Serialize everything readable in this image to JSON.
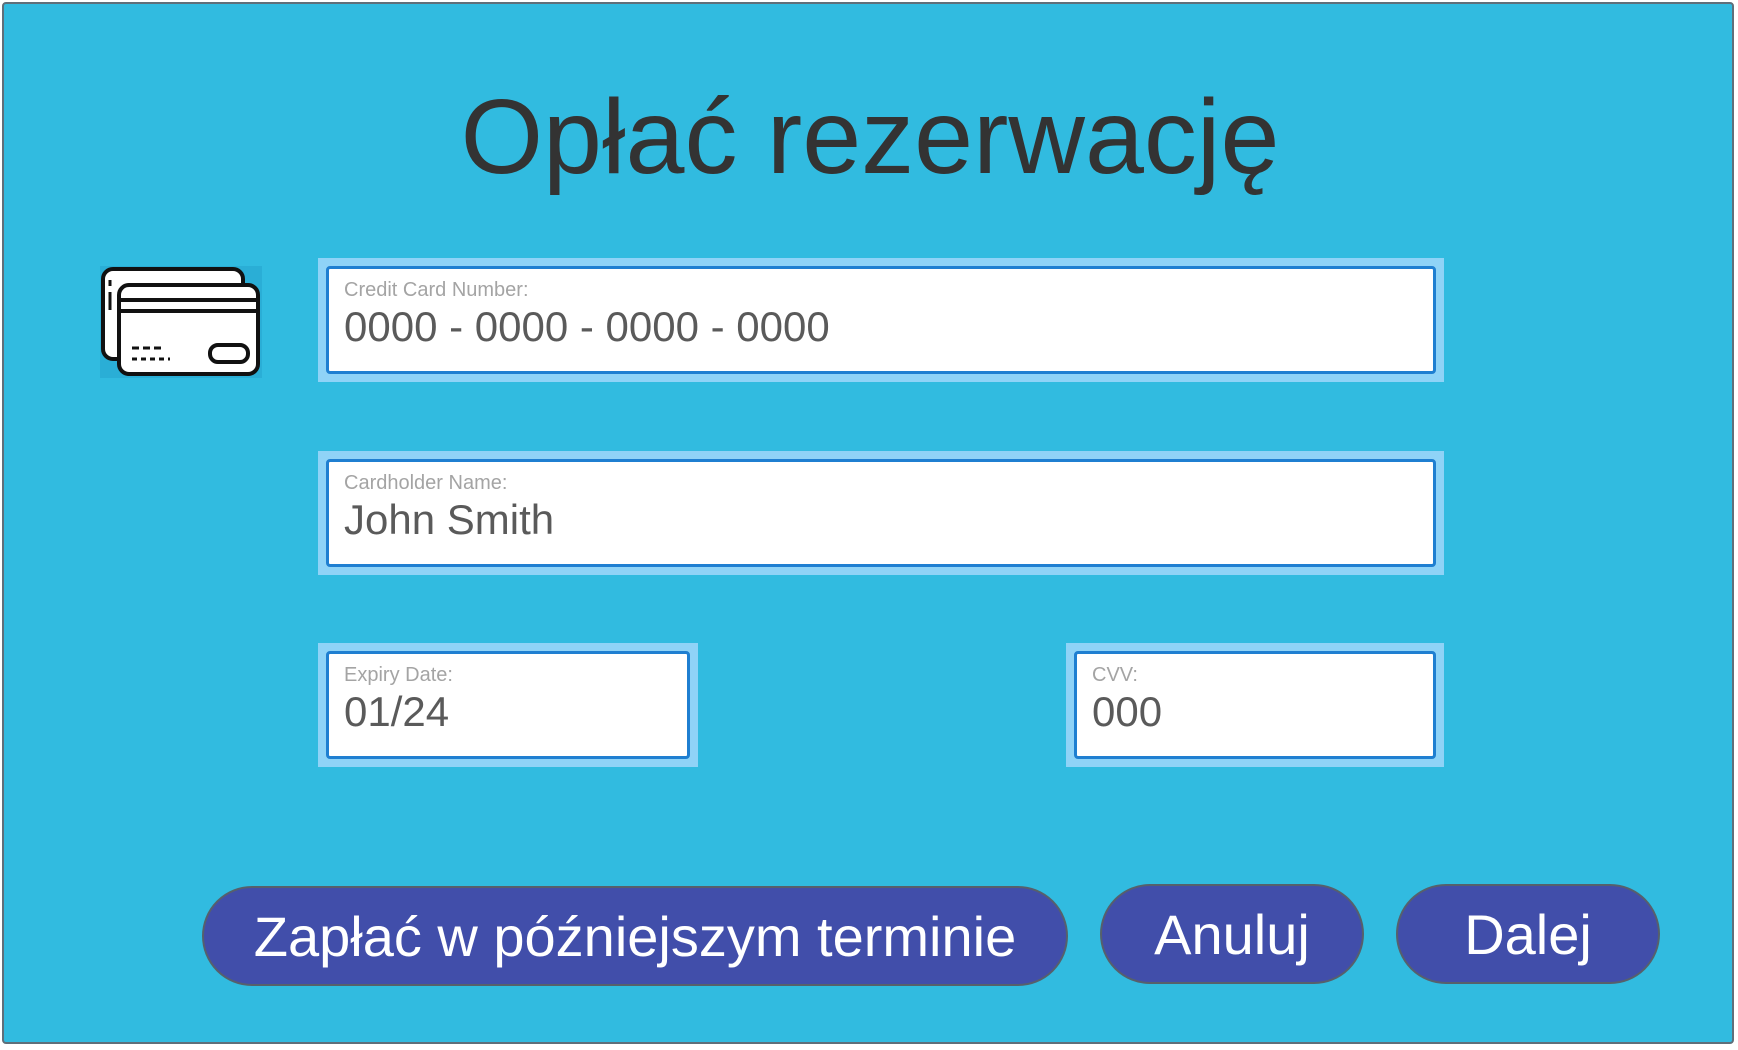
{
  "page": {
    "title": "Opłać rezerwację"
  },
  "icon": {
    "name": "credit-cards-icon"
  },
  "form": {
    "card_number": {
      "label": "Credit Card Number:",
      "value": "0000 - 0000 - 0000 - 0000"
    },
    "cardholder": {
      "label": "Cardholder Name:",
      "value": "John Smith"
    },
    "expiry": {
      "label": "Expiry Date:",
      "value": "01/24"
    },
    "cvv": {
      "label": "CVV:",
      "value": "000"
    }
  },
  "actions": {
    "pay_later": "Zapłać w późniejszym terminie",
    "cancel": "Anuluj",
    "next": "Dalej"
  },
  "colors": {
    "background": "#31bbe0",
    "button": "#414eaa",
    "field_border": "#1f7fd1",
    "field_glow": "#8fd3f7",
    "title_text": "#333333"
  }
}
